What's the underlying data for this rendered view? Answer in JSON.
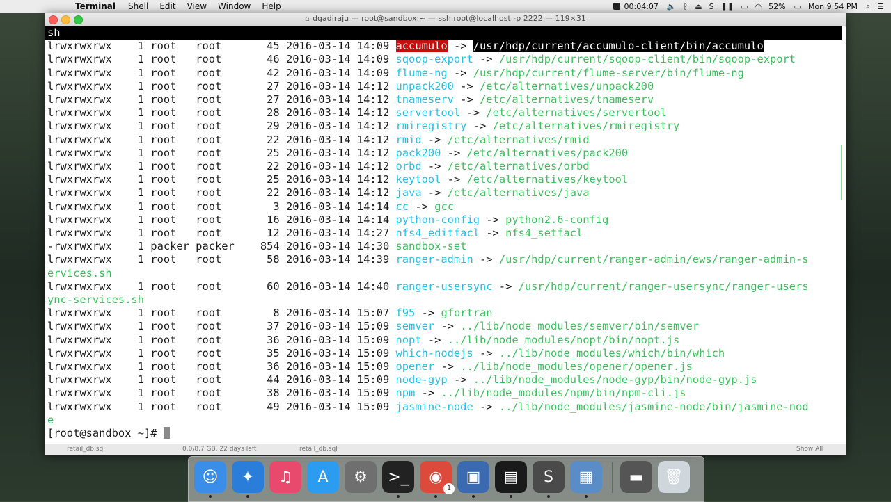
{
  "menubar": {
    "app_name": "Terminal",
    "items": [
      "Shell",
      "Edit",
      "View",
      "Window",
      "Help"
    ],
    "timer": "00:04:07",
    "battery": "52%",
    "clock": "Mon 9:54 PM"
  },
  "window": {
    "title": "dgadiraju — root@sandbox:~ — ssh root@localhost -p 2222 — 119×31"
  },
  "terminal": {
    "top_line": "sh",
    "rows": [
      {
        "perm": "lrwxrwxrwx",
        "links": "1",
        "owner": "root",
        "group": "root",
        "size": "45",
        "date": "2016-03-14",
        "time": "14:09",
        "name": "accumulo",
        "arrow": "->",
        "target": "/usr/hdp/current/accumulo-client/bin/accumulo",
        "style": "hl"
      },
      {
        "perm": "lrwxrwxrwx",
        "links": "1",
        "owner": "root",
        "group": "root",
        "size": "46",
        "date": "2016-03-14",
        "time": "14:09",
        "name": "sqoop-export",
        "arrow": "->",
        "target": "/usr/hdp/current/sqoop-client/bin/sqoop-export",
        "style": "green"
      },
      {
        "perm": "lrwxrwxrwx",
        "links": "1",
        "owner": "root",
        "group": "root",
        "size": "42",
        "date": "2016-03-14",
        "time": "14:09",
        "name": "flume-ng",
        "arrow": "->",
        "target": "/usr/hdp/current/flume-server/bin/flume-ng",
        "style": "green"
      },
      {
        "perm": "lrwxrwxrwx",
        "links": "1",
        "owner": "root",
        "group": "root",
        "size": "27",
        "date": "2016-03-14",
        "time": "14:12",
        "name": "unpack200",
        "arrow": "->",
        "target": "/etc/alternatives/unpack200",
        "style": "green"
      },
      {
        "perm": "lrwxrwxrwx",
        "links": "1",
        "owner": "root",
        "group": "root",
        "size": "27",
        "date": "2016-03-14",
        "time": "14:12",
        "name": "tnameserv",
        "arrow": "->",
        "target": "/etc/alternatives/tnameserv",
        "style": "green"
      },
      {
        "perm": "lrwxrwxrwx",
        "links": "1",
        "owner": "root",
        "group": "root",
        "size": "28",
        "date": "2016-03-14",
        "time": "14:12",
        "name": "servertool",
        "arrow": "->",
        "target": "/etc/alternatives/servertool",
        "style": "green"
      },
      {
        "perm": "lrwxrwxrwx",
        "links": "1",
        "owner": "root",
        "group": "root",
        "size": "29",
        "date": "2016-03-14",
        "time": "14:12",
        "name": "rmiregistry",
        "arrow": "->",
        "target": "/etc/alternatives/rmiregistry",
        "style": "green"
      },
      {
        "perm": "lrwxrwxrwx",
        "links": "1",
        "owner": "root",
        "group": "root",
        "size": "22",
        "date": "2016-03-14",
        "time": "14:12",
        "name": "rmid",
        "arrow": "->",
        "target": "/etc/alternatives/rmid",
        "style": "green"
      },
      {
        "perm": "lrwxrwxrwx",
        "links": "1",
        "owner": "root",
        "group": "root",
        "size": "25",
        "date": "2016-03-14",
        "time": "14:12",
        "name": "pack200",
        "arrow": "->",
        "target": "/etc/alternatives/pack200",
        "style": "green"
      },
      {
        "perm": "lrwxrwxrwx",
        "links": "1",
        "owner": "root",
        "group": "root",
        "size": "22",
        "date": "2016-03-14",
        "time": "14:12",
        "name": "orbd",
        "arrow": "->",
        "target": "/etc/alternatives/orbd",
        "style": "green"
      },
      {
        "perm": "lrwxrwxrwx",
        "links": "1",
        "owner": "root",
        "group": "root",
        "size": "25",
        "date": "2016-03-14",
        "time": "14:12",
        "name": "keytool",
        "arrow": "->",
        "target": "/etc/alternatives/keytool",
        "style": "green"
      },
      {
        "perm": "lrwxrwxrwx",
        "links": "1",
        "owner": "root",
        "group": "root",
        "size": "22",
        "date": "2016-03-14",
        "time": "14:12",
        "name": "java",
        "arrow": "->",
        "target": "/etc/alternatives/java",
        "style": "green"
      },
      {
        "perm": "lrwxrwxrwx",
        "links": "1",
        "owner": "root",
        "group": "root",
        "size": "3",
        "date": "2016-03-14",
        "time": "14:14",
        "name": "cc",
        "arrow": "->",
        "target": "gcc",
        "style": "green"
      },
      {
        "perm": "lrwxrwxrwx",
        "links": "1",
        "owner": "root",
        "group": "root",
        "size": "16",
        "date": "2016-03-14",
        "time": "14:14",
        "name": "python-config",
        "arrow": "->",
        "target": "python2.6-config",
        "style": "green"
      },
      {
        "perm": "lrwxrwxrwx",
        "links": "1",
        "owner": "root",
        "group": "root",
        "size": "12",
        "date": "2016-03-14",
        "time": "14:27",
        "name": "nfs4_editfacl",
        "arrow": "->",
        "target": "nfs4_setfacl",
        "style": "green"
      },
      {
        "perm": "-rwxrwxrwx",
        "links": "1",
        "owner": "packer",
        "group": "packer",
        "size": "854",
        "date": "2016-03-14",
        "time": "14:30",
        "name": "sandbox-set",
        "arrow": "",
        "target": "",
        "style": "exec"
      },
      {
        "perm": "lrwxrwxrwx",
        "links": "1",
        "owner": "root",
        "group": "root",
        "size": "58",
        "date": "2016-03-14",
        "time": "14:39",
        "name": "ranger-admin",
        "arrow": "->",
        "target": "/usr/hdp/current/ranger-admin/ews/ranger-admin-s",
        "wrap": "ervices.sh",
        "style": "green"
      },
      {
        "perm": "lrwxrwxrwx",
        "links": "1",
        "owner": "root",
        "group": "root",
        "size": "60",
        "date": "2016-03-14",
        "time": "14:40",
        "name": "ranger-usersync",
        "arrow": "->",
        "target": "/usr/hdp/current/ranger-usersync/ranger-users",
        "wrap": "ync-services.sh",
        "style": "green"
      },
      {
        "perm": "lrwxrwxrwx",
        "links": "1",
        "owner": "root",
        "group": "root",
        "size": "8",
        "date": "2016-03-14",
        "time": "15:07",
        "name": "f95",
        "arrow": "->",
        "target": "gfortran",
        "style": "green"
      },
      {
        "perm": "lrwxrwxrwx",
        "links": "1",
        "owner": "root",
        "group": "root",
        "size": "37",
        "date": "2016-03-14",
        "time": "15:09",
        "name": "semver",
        "arrow": "->",
        "target": "../lib/node_modules/semver/bin/semver",
        "style": "green"
      },
      {
        "perm": "lrwxrwxrwx",
        "links": "1",
        "owner": "root",
        "group": "root",
        "size": "36",
        "date": "2016-03-14",
        "time": "15:09",
        "name": "nopt",
        "arrow": "->",
        "target": "../lib/node_modules/nopt/bin/nopt.js",
        "style": "green"
      },
      {
        "perm": "lrwxrwxrwx",
        "links": "1",
        "owner": "root",
        "group": "root",
        "size": "35",
        "date": "2016-03-14",
        "time": "15:09",
        "name": "which-nodejs",
        "arrow": "->",
        "target": "../lib/node_modules/which/bin/which",
        "style": "green"
      },
      {
        "perm": "lrwxrwxrwx",
        "links": "1",
        "owner": "root",
        "group": "root",
        "size": "36",
        "date": "2016-03-14",
        "time": "15:09",
        "name": "opener",
        "arrow": "->",
        "target": "../lib/node_modules/opener/opener.js",
        "style": "green"
      },
      {
        "perm": "lrwxrwxrwx",
        "links": "1",
        "owner": "root",
        "group": "root",
        "size": "44",
        "date": "2016-03-14",
        "time": "15:09",
        "name": "node-gyp",
        "arrow": "->",
        "target": "../lib/node_modules/node-gyp/bin/node-gyp.js",
        "style": "green"
      },
      {
        "perm": "lrwxrwxrwx",
        "links": "1",
        "owner": "root",
        "group": "root",
        "size": "38",
        "date": "2016-03-14",
        "time": "15:09",
        "name": "npm",
        "arrow": "->",
        "target": "../lib/node_modules/npm/bin/npm-cli.js",
        "style": "green"
      },
      {
        "perm": "lrwxrwxrwx",
        "links": "1",
        "owner": "root",
        "group": "root",
        "size": "49",
        "date": "2016-03-14",
        "time": "15:09",
        "name": "jasmine-node",
        "arrow": "->",
        "target": "../lib/node_modules/jasmine-node/bin/jasmine-nod",
        "wrap": "e",
        "style": "green"
      }
    ],
    "prompt": "[root@sandbox ~]# "
  },
  "background_window": {
    "items": [
      "retail_db.sql",
      "0.0/8.7 GB, 22 days left",
      "retail_db.sql",
      "Show All"
    ]
  },
  "dock": {
    "apps": [
      {
        "name": "finder",
        "glyph": "☺",
        "color": "#3a8ee8"
      },
      {
        "name": "safari",
        "glyph": "✦",
        "color": "#2a7ed9"
      },
      {
        "name": "itunes",
        "glyph": "♫",
        "color": "#e84a6e"
      },
      {
        "name": "app-store",
        "glyph": "A",
        "color": "#2c9cf0"
      },
      {
        "name": "system-preferences",
        "glyph": "⚙",
        "color": "#6f6f6f"
      },
      {
        "name": "terminal",
        "glyph": ">_",
        "color": "#222222"
      },
      {
        "name": "chrome",
        "glyph": "◉",
        "color": "#dc4a3c"
      },
      {
        "name": "virtualbox",
        "glyph": "▣",
        "color": "#3b6ab0"
      },
      {
        "name": "photo-booth",
        "glyph": "▤",
        "color": "#1a1a1a"
      },
      {
        "name": "sublime-text",
        "glyph": "S",
        "color": "#4a4a4a"
      },
      {
        "name": "preview",
        "glyph": "▦",
        "color": "#5a8cc8"
      },
      {
        "name": "device",
        "glyph": "▬",
        "color": "#555555"
      },
      {
        "name": "trash",
        "glyph": "🗑",
        "color": "#cfd6dc"
      }
    ],
    "badge": "1"
  },
  "colors": {
    "link": "#23c0e6",
    "green": "#39c05a",
    "highlight_red": "#c50f0f"
  }
}
